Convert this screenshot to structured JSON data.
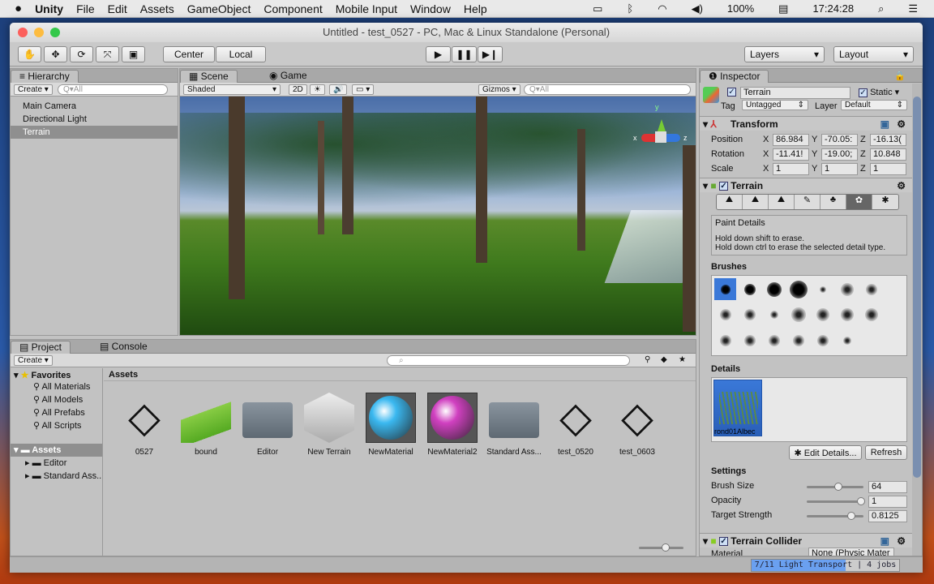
{
  "menubar": {
    "apple": "",
    "app": "Unity",
    "items": [
      "File",
      "Edit",
      "Assets",
      "GameObject",
      "Component",
      "Mobile Input",
      "Window",
      "Help"
    ],
    "battery": "100%",
    "time": "17:24:28"
  },
  "window": {
    "title": "Untitled - test_0527 - PC, Mac & Linux Standalone (Personal)"
  },
  "toolbar": {
    "center": "Center",
    "local": "Local",
    "layers": "Layers",
    "layout": "Layout"
  },
  "hierarchy": {
    "tab": "Hierarchy",
    "create": "Create",
    "search_placeholder": "Q▾All",
    "items": [
      "Main Camera",
      "Directional Light",
      "Terrain"
    ],
    "selected": 2
  },
  "scene": {
    "tab_scene": "Scene",
    "tab_game": "Game",
    "shaded": "Shaded",
    "mode2d": "2D",
    "gizmos": "Gizmos",
    "search_placeholder": "Q▾All",
    "axis_x": "x",
    "axis_y": "y",
    "axis_z": "z"
  },
  "project": {
    "tab": "Project",
    "console_tab": "Console",
    "create": "Create",
    "favorites": "Favorites",
    "fav_items": [
      "All Materials",
      "All Models",
      "All Prefabs",
      "All Scripts"
    ],
    "assets_root": "Assets",
    "asset_folders": [
      "Editor",
      "Standard Ass..."
    ],
    "assets_header": "Assets",
    "assets": [
      {
        "name": "0527",
        "type": "unity"
      },
      {
        "name": "bound",
        "type": "bound"
      },
      {
        "name": "Editor",
        "type": "folder"
      },
      {
        "name": "New Terrain",
        "type": "terrain"
      },
      {
        "name": "NewMaterial",
        "type": "mat-blue"
      },
      {
        "name": "NewMaterial2",
        "type": "mat-pink"
      },
      {
        "name": "Standard Ass...",
        "type": "folder"
      },
      {
        "name": "test_0520",
        "type": "unity"
      },
      {
        "name": "test_0603",
        "type": "unity"
      }
    ]
  },
  "inspector": {
    "tab": "Inspector",
    "object_name": "Terrain",
    "static": "Static",
    "tag_label": "Tag",
    "tag": "Untagged",
    "layer_label": "Layer",
    "layer": "Default",
    "transform": {
      "title": "Transform",
      "position_label": "Position",
      "rotation_label": "Rotation",
      "scale_label": "Scale",
      "position": [
        "86.984",
        "-70.05:",
        "-16.13("
      ],
      "rotation": [
        "-11.41!",
        "-19.00;",
        "10.848"
      ],
      "scale": [
        "1",
        "1",
        "1"
      ],
      "x": "X",
      "y": "Y",
      "z": "Z"
    },
    "terrain": {
      "title": "Terrain",
      "paint_title": "Paint Details",
      "hint1": "Hold down shift to erase.",
      "hint2": "Hold down ctrl to erase the selected detail type.",
      "brushes_label": "Brushes",
      "details_label": "Details",
      "detail_name": "rond01Albec",
      "edit_details": "✱ Edit Details...",
      "refresh": "Refresh",
      "settings_label": "Settings",
      "settings": [
        {
          "label": "Brush Size",
          "value": "64",
          "fraction": 0.55
        },
        {
          "label": "Opacity",
          "value": "1",
          "fraction": 1.0
        },
        {
          "label": "Target Strength",
          "value": "0.8125",
          "fraction": 0.8125
        }
      ]
    },
    "collider": {
      "title": "Terrain Collider",
      "material_label": "Material",
      "material": "None (Physic Mater"
    }
  },
  "status": {
    "progress_text": "7/11 Light Transport | 4 jobs",
    "progress": 0.64
  }
}
